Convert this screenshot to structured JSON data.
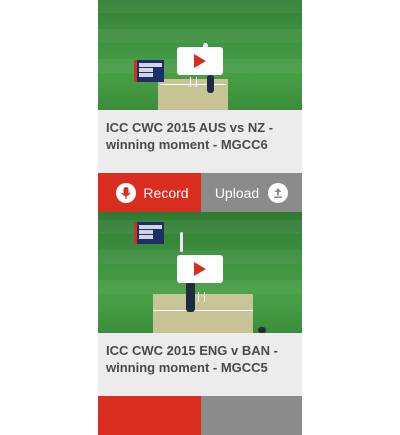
{
  "actions": {
    "record_label": "Record",
    "upload_label": "Upload"
  },
  "videos": [
    {
      "title": "ICC CWC 2015 AUS vs NZ - winning moment - MGCC6"
    },
    {
      "title": "ICC CWC 2015 ENG v BAN - winning moment - MGCC5"
    }
  ],
  "colors": {
    "record": "#d92d20",
    "upload": "#8b8b8b",
    "caption_bg": "#ececec"
  },
  "icons": {
    "record": "record-icon",
    "upload": "upload-icon",
    "play": "play-icon"
  }
}
